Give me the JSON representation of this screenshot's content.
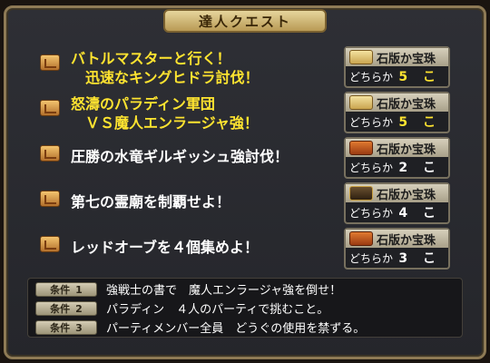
{
  "title": "達人クエスト",
  "quests": [
    {
      "title": "バトルマスターと行く！\n　迅速なキングヒドラ討伐！",
      "highlight": true,
      "reward": {
        "icon": "scroll-icon",
        "name": "石版か宝珠",
        "choice": "どちらか",
        "count": "5 こ"
      }
    },
    {
      "title": "怒濤のパラディン軍団\n　ＶＳ魔人エンラージャ強！",
      "highlight": true,
      "reward": {
        "icon": "scroll-icon",
        "name": "石版か宝珠",
        "choice": "どちらか",
        "count": "5 こ"
      }
    },
    {
      "title": "圧勝の水竜ギルギッシュ強討伐！",
      "highlight": false,
      "reward": {
        "icon": "treasure-chest-icon",
        "name": "石版か宝珠",
        "choice": "どちらか",
        "count": "2 こ"
      }
    },
    {
      "title": "第七の霊廟を制覇せよ！",
      "highlight": false,
      "reward": {
        "icon": "dark-treasure-chest-icon",
        "name": "石版か宝珠",
        "choice": "どちらか",
        "count": "4 こ"
      }
    },
    {
      "title": "レッドオーブを４個集めよ！",
      "highlight": false,
      "reward": {
        "icon": "treasure-chest-icon",
        "name": "石版か宝珠",
        "choice": "どちらか",
        "count": "3 こ"
      }
    }
  ],
  "conditions": [
    {
      "label": "条件",
      "number": "1",
      "text": "強戦士の書で　魔人エンラージャ強を倒せ！"
    },
    {
      "label": "条件",
      "number": "2",
      "text": "パラディン　４人のパーティで挑むこと。"
    },
    {
      "label": "条件",
      "number": "3",
      "text": "パーティメンバー全員　どうぐの使用を禁ずる。"
    }
  ],
  "colors": {
    "highlight_text": "#ffe430",
    "normal_text": "#ffffff",
    "frame_border": "#8e7a55"
  }
}
